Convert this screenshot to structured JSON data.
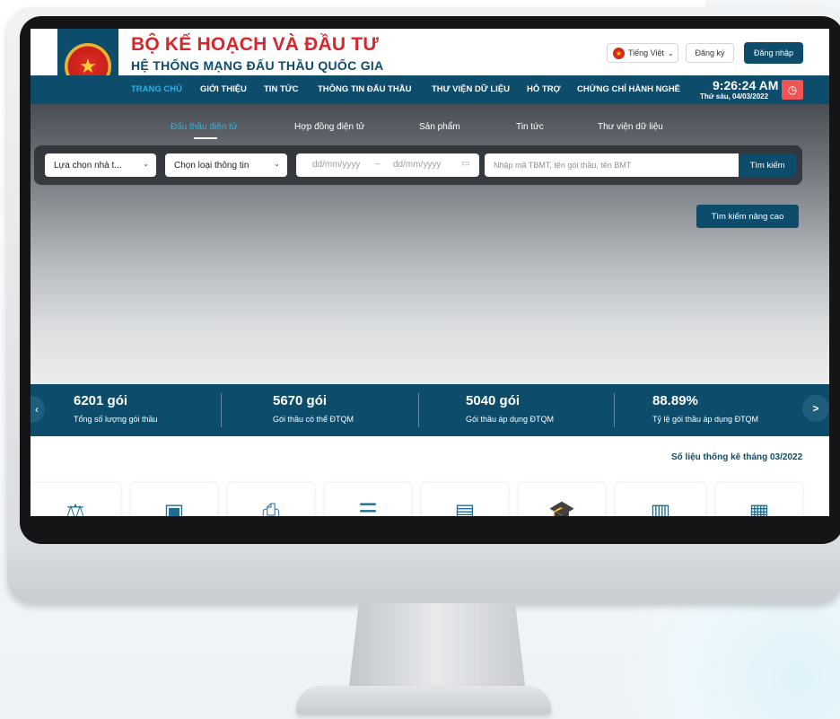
{
  "header": {
    "title": "BỘ KẾ HOẠCH VÀ ĐẦU TƯ",
    "subtitle": "HỆ THỐNG MẠNG ĐẤU THẦU QUỐC GIA",
    "language": "Tiếng Việt",
    "register_label": "Đăng ký",
    "login_label": "Đăng nhập"
  },
  "nav": {
    "items": [
      "TRANG CHỦ",
      "GIỚI THIỆU",
      "TIN TỨC",
      "THÔNG TIN ĐẤU THẦU",
      "THƯ VIỆN DỮ LIỆU",
      "HỖ TRỢ",
      "CHỨNG CHỈ HÀNH NGHỀ"
    ],
    "active": "TRANG CHỦ",
    "time": "9:26:24 AM",
    "date": "Thứ sáu, 04/03/2022"
  },
  "tabs": [
    "Đấu thầu điện tử",
    "Hợp đồng điện tử",
    "Sản phẩm",
    "Tin tức",
    "Thư viện dữ liệu"
  ],
  "search": {
    "select_investor": "Lựa chọn nhà t...",
    "select_type": "Chọn loại thông tin",
    "date_from_placeholder": "dd/mm/yyyy",
    "date_sep": "~",
    "date_to_placeholder": "dd/mm/yyyy",
    "keyword_placeholder": "Nhập mã TBMT, tên gói thầu, tên BMT",
    "search_label": "Tìm kiếm",
    "advanced_label": "Tìm kiếm nâng cao"
  },
  "stats": [
    {
      "value": "6201 gói",
      "label": "Tổng số lượng gói thầu"
    },
    {
      "value": "5670 gói",
      "label": "Gói thầu có thể ĐTQM"
    },
    {
      "value": "5040 gói",
      "label": "Gói thầu áp dụng ĐTQM"
    },
    {
      "value": "88.89%",
      "label": "Tỷ lệ gói thầu áp dụng ĐTQM"
    }
  ],
  "month_stat_label": "Số liệu thống kê tháng 03/2022",
  "categories_icons": [
    "gavel-icon",
    "laptop-icon",
    "printer-icon",
    "document-list-icon",
    "laptop-folder-icon",
    "graduation-cap-icon",
    "book-star-icon",
    "building-icon"
  ],
  "colors": {
    "brand_blue": "#0e4c6b",
    "brand_red": "#d6282c",
    "active_nav": "#2ab3e6",
    "clock_red": "#f05454"
  }
}
